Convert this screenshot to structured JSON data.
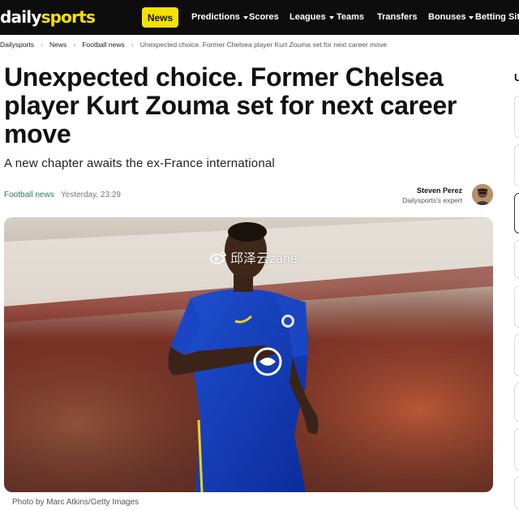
{
  "header": {
    "logo_main": "daily",
    "logo_accent": "sports",
    "nav": {
      "news": "News",
      "predictions": "Predictions",
      "scores": "Scores",
      "leagues": "Leagues",
      "teams": "Teams",
      "transfers": "Transfers",
      "bonuses": "Bonuses",
      "betting_sites": "Betting Sites"
    }
  },
  "breadcrumb": {
    "items": [
      "Dailysports",
      "News",
      "Football news"
    ],
    "current": "Unexpected choice. Former Chelsea player Kurt Zouma set for next career move"
  },
  "article": {
    "title": "Unexpected choice. Former Chelsea player Kurt Zouma set for next career move",
    "subtitle": "A new chapter awaits the ex-France international",
    "category": "Football news",
    "timestamp": "Yesterday, 23:29",
    "author_name": "Steven Perez",
    "author_role": "Dailysports's expert",
    "photo_credit": "Photo by Marc Atkins/Getty Images",
    "watermark": "邱泽云zane"
  },
  "sidebar": {
    "heading_fragment": "U"
  },
  "colors": {
    "accent": "#f5e100",
    "category_green": "#2e7d4f",
    "topbar": "#0d0d0d"
  },
  "icons": [
    "chevron-down-icon",
    "weibo-icon",
    "avatar"
  ]
}
